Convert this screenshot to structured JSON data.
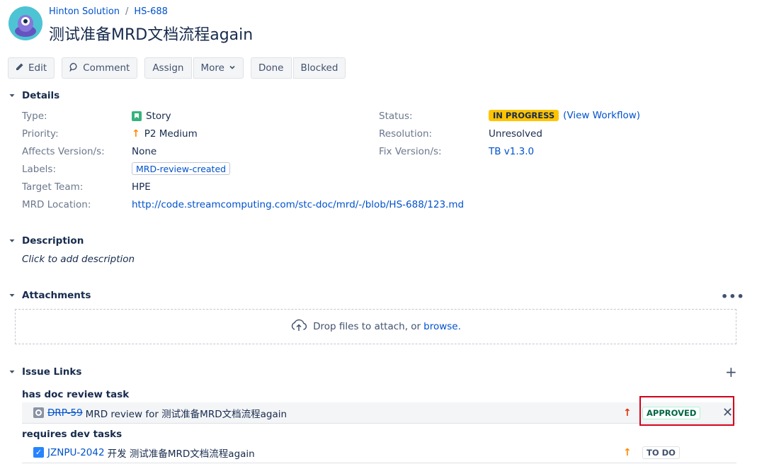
{
  "breadcrumb": {
    "project": "Hinton Solution",
    "separator": "/",
    "issue_key": "HS-688"
  },
  "title": "测试准备MRD文档流程again",
  "toolbar": {
    "edit": "Edit",
    "comment": "Comment",
    "assign": "Assign",
    "more": "More",
    "done": "Done",
    "blocked": "Blocked"
  },
  "details": {
    "heading": "Details",
    "type_label": "Type:",
    "type_value": "Story",
    "priority_label": "Priority:",
    "priority_value": "P2 Medium",
    "affects_label": "Affects Version/s:",
    "affects_value": "None",
    "labels_label": "Labels:",
    "labels_value": "MRD-review-created",
    "team_label": "Target Team:",
    "team_value": "HPE",
    "mrd_label": "MRD Location:",
    "mrd_value": "http://code.streamcomputing.com/stc-doc/mrd/-/blob/HS-688/123.md",
    "status_label": "Status:",
    "status_value": "IN PROGRESS",
    "workflow_link": "(View Workflow)",
    "resolution_label": "Resolution:",
    "resolution_value": "Unresolved",
    "fix_label": "Fix Version/s:",
    "fix_value": "TB v1.3.0"
  },
  "description": {
    "heading": "Description",
    "placeholder": "Click to add description"
  },
  "attachments": {
    "heading": "Attachments",
    "more": "•••",
    "drop_text": "Drop files to attach, or",
    "browse": "browse."
  },
  "issue_links": {
    "heading": "Issue Links",
    "add": "+",
    "groups": [
      {
        "type": "has doc review task",
        "key": "DRP-59",
        "summary": "MRD review for 测试准备MRD文档流程again",
        "status": "APPROVED",
        "priority": "high",
        "remove": "✕"
      },
      {
        "type": "requires dev tasks",
        "key": "JZNPU-2042",
        "summary": "开发 测试准备MRD文档流程again",
        "status": "TO DO",
        "priority": "medium"
      }
    ]
  },
  "colors": {
    "status_in_progress": "#ffc400",
    "link": "#0052cc",
    "approved": "#006644",
    "highlight": "#d0021b"
  }
}
